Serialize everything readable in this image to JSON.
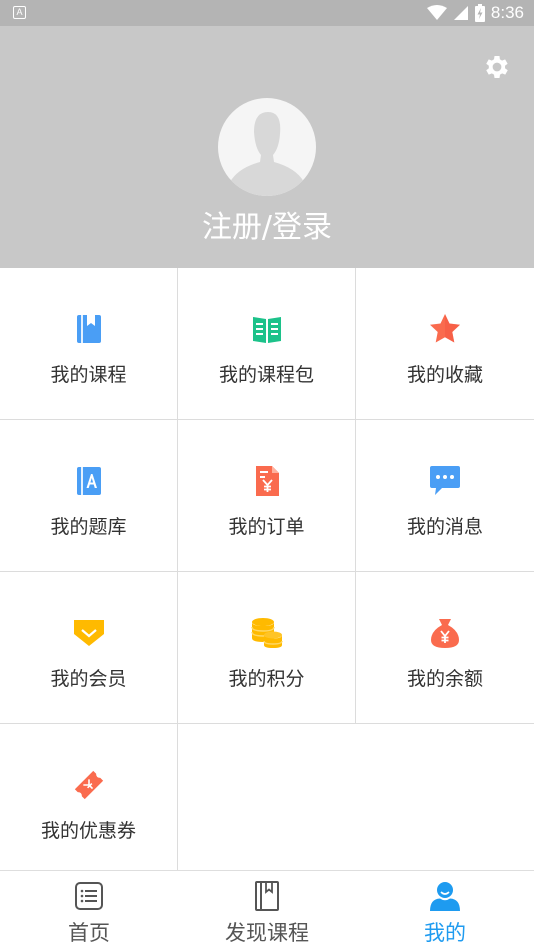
{
  "status_bar": {
    "notification_icon": "a-letter-icon",
    "time": "8:36"
  },
  "header": {
    "login_label": "注册/登录",
    "background": "#c8c8c8"
  },
  "grid": {
    "items": [
      {
        "label": "我的课程",
        "icon": "book-icon",
        "color": "#4a9ef5"
      },
      {
        "label": "我的课程包",
        "icon": "open-book-icon",
        "color": "#1cc28a"
      },
      {
        "label": "我的收藏",
        "icon": "star-icon",
        "color": "#fa6b4e"
      },
      {
        "label": "我的题库",
        "icon": "question-bank-icon",
        "color": "#4a9ef5"
      },
      {
        "label": "我的订单",
        "icon": "order-icon",
        "color": "#fa6b4e"
      },
      {
        "label": "我的消息",
        "icon": "message-icon",
        "color": "#4a9ef5"
      },
      {
        "label": "我的会员",
        "icon": "vip-icon",
        "color": "#ffba00"
      },
      {
        "label": "我的积分",
        "icon": "coins-icon",
        "color": "#ffba00"
      },
      {
        "label": "我的余额",
        "icon": "money-bag-icon",
        "color": "#fa6b4e"
      },
      {
        "label": "我的优惠券",
        "icon": "coupon-icon",
        "color": "#fa6b4e"
      }
    ]
  },
  "bottom_nav": {
    "items": [
      {
        "label": "首页",
        "icon": "list-icon"
      },
      {
        "label": "发现课程",
        "icon": "bookmark-book-icon"
      },
      {
        "label": "我的",
        "icon": "user-icon"
      }
    ],
    "active_index": 2,
    "active_color": "#1e9bf0"
  }
}
